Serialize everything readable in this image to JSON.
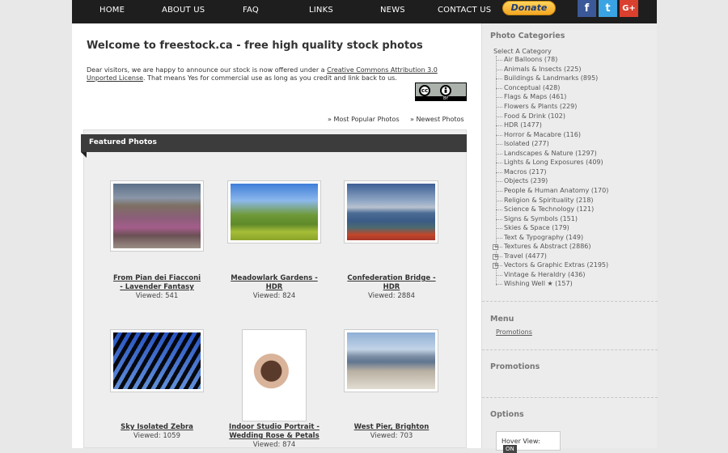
{
  "nav": {
    "items": [
      "HOME",
      "ABOUT US",
      "FAQ",
      "LINKS",
      "NEWS",
      "CONTACT US"
    ],
    "donate": "Donate",
    "social": [
      "f",
      "t",
      "G+"
    ]
  },
  "main": {
    "title": "Welcome to freestock.ca - free high quality stock photos",
    "intro_before": "Dear visitors, we are happy to announce our stock is now offered under a ",
    "intro_link": "Creative Commons Attribution 3.0 Unported License",
    "intro_after": ". That means Yes for commercial use as long as you credit and link back to us.",
    "cc_badge": {
      "cc": "cc",
      "by": "BY"
    },
    "link_popular": "» Most Popular Photos",
    "link_newest": "» Newest Photos",
    "featured_heading": "Featured Photos",
    "photos": [
      {
        "title_1": "From Pian dei Fiacconi",
        "title_2": "- Lavender Fantasy",
        "viewed": "Viewed: 541"
      },
      {
        "title_1": "Meadowlark Gardens -",
        "title_2": "HDR",
        "viewed": "Viewed: 824"
      },
      {
        "title_1": "Confederation Bridge -",
        "title_2": "HDR",
        "viewed": "Viewed: 2884"
      },
      {
        "title_1": "Sky Isolated Zebra",
        "title_2": "",
        "viewed": "Viewed: 1059"
      },
      {
        "title_1": "Indoor Studio Portrait -",
        "title_2": "Wedding Rose & Petals",
        "viewed": "Viewed: 874"
      },
      {
        "title_1": "West Pier, Brighton",
        "title_2": "",
        "viewed": "Viewed: 703"
      }
    ]
  },
  "sidebar": {
    "categories_heading": "Photo Categories",
    "select_label": "Select A Category",
    "categories": [
      "Air Balloons (78)",
      "Animals & Insects (225)",
      "Buildings & Landmarks (895)",
      "Conceptual (428)",
      "Flags & Maps (461)",
      "Flowers & Plants (229)",
      "Food & Drink (102)",
      "HDR (1477)",
      "Horror & Macabre (116)",
      "Isolated (277)",
      "Landscapes & Nature (1297)",
      "Lights & Long Exposures (409)",
      "Macros (217)",
      "Objects (239)",
      "People & Human Anatomy (170)",
      "Religion & Spirituality (218)",
      "Science & Technology (121)",
      "Signs & Symbols (151)",
      "Skies & Space (179)",
      "Text & Typography (149)",
      "Textures & Abstract (2886)",
      "Travel (4477)",
      "Vectors & Graphic Extras (2195)",
      "Vintage & Heraldry (436)",
      "Wishing Well ★ (157)"
    ],
    "menu_heading": "Menu",
    "menu_item": "Promotions",
    "promotions_heading": "Promotions",
    "options_heading": "Options",
    "hover_view_label": "Hover View:",
    "hover_view_value": "ON"
  }
}
